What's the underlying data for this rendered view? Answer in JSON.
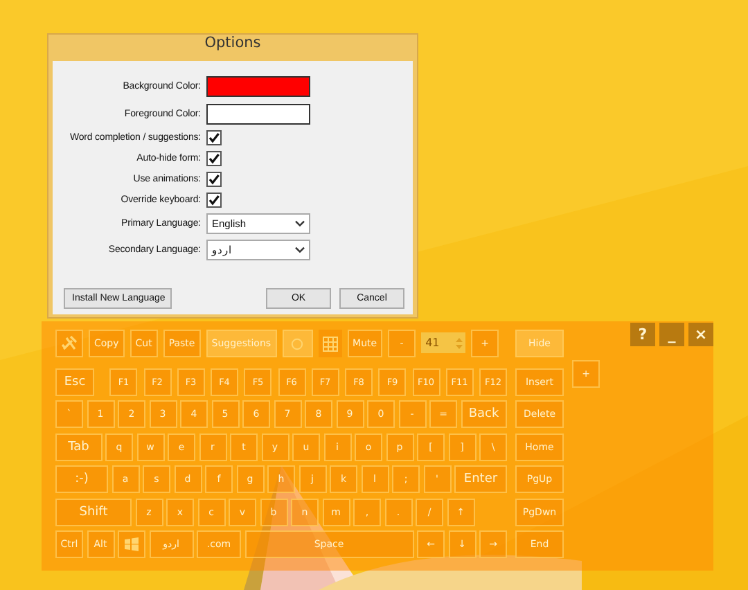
{
  "window": {
    "title": "Options"
  },
  "fields": [
    {
      "kind": "color",
      "label": "Background Color:",
      "color": "#ff0000"
    },
    {
      "kind": "color",
      "label": "Foreground Color:",
      "color": "#ffffff"
    },
    {
      "kind": "checkbox",
      "label": "Word completion / suggestions:",
      "checked": true
    },
    {
      "kind": "checkbox",
      "label": "Auto-hide form:",
      "checked": true
    },
    {
      "kind": "checkbox",
      "label": "Use animations:",
      "checked": true
    },
    {
      "kind": "checkbox",
      "label": "Override keyboard:",
      "checked": true
    },
    {
      "kind": "select",
      "label": "Primary Language:",
      "value": "English"
    },
    {
      "kind": "select",
      "label": "Secondary Language:",
      "value": "اردو"
    }
  ],
  "buttons": [
    "Install New Language",
    "OK",
    "Cancel"
  ],
  "keyboard": {
    "window_buttons": [
      "?",
      "_",
      "×"
    ],
    "toolbar": [
      {
        "kind": "tools",
        "on": false
      },
      {
        "kind": "key",
        "label": "Copy",
        "on": false
      },
      {
        "kind": "key",
        "label": "Cut",
        "on": false
      },
      {
        "kind": "key",
        "label": "Paste",
        "on": false
      },
      {
        "kind": "key",
        "label": "Suggestions",
        "on": true
      },
      {
        "kind": "circle",
        "on": true
      },
      {
        "kind": "grid",
        "on": false
      },
      {
        "kind": "key",
        "label": "Mute",
        "on": false
      },
      {
        "kind": "key",
        "label": "-",
        "on": false
      },
      {
        "kind": "spinner",
        "value": "41"
      },
      {
        "kind": "key",
        "label": "+",
        "on": false
      }
    ],
    "rows": [
      {
        "keys": [
          {
            "kind": "esc",
            "label": "Esc"
          },
          {
            "kind": "fn",
            "label": "F1"
          },
          {
            "kind": "fn",
            "label": "F2"
          },
          {
            "kind": "fn",
            "label": "F3"
          },
          {
            "kind": "fn",
            "label": "F4"
          },
          {
            "kind": "fn",
            "label": "F5"
          },
          {
            "kind": "fn",
            "label": "F6"
          },
          {
            "kind": "fn",
            "label": "F7"
          },
          {
            "kind": "fn",
            "label": "F8"
          },
          {
            "kind": "fn",
            "label": "F9"
          },
          {
            "kind": "fn",
            "label": "F10"
          },
          {
            "kind": "fn",
            "label": "F11"
          },
          {
            "kind": "fn",
            "label": "F12"
          }
        ]
      },
      {
        "keys": [
          {
            "kind": "key",
            "label": "`"
          },
          {
            "kind": "key",
            "label": "1"
          },
          {
            "kind": "key",
            "label": "2"
          },
          {
            "kind": "key",
            "label": "3"
          },
          {
            "kind": "key",
            "label": "4"
          },
          {
            "kind": "key",
            "label": "5"
          },
          {
            "kind": "key",
            "label": "6"
          },
          {
            "kind": "key",
            "label": "7"
          },
          {
            "kind": "key",
            "label": "8"
          },
          {
            "kind": "key",
            "label": "9"
          },
          {
            "kind": "key",
            "label": "0"
          },
          {
            "kind": "key",
            "label": "-"
          },
          {
            "kind": "key",
            "label": "="
          },
          {
            "kind": "wide",
            "label": "Back"
          }
        ]
      },
      {
        "keys": [
          {
            "kind": "wide",
            "label": "Tab"
          },
          {
            "kind": "key",
            "label": "q"
          },
          {
            "kind": "key",
            "label": "w"
          },
          {
            "kind": "key",
            "label": "e"
          },
          {
            "kind": "key",
            "label": "r"
          },
          {
            "kind": "key",
            "label": "t"
          },
          {
            "kind": "key",
            "label": "y"
          },
          {
            "kind": "key",
            "label": "u"
          },
          {
            "kind": "key",
            "label": "i"
          },
          {
            "kind": "key",
            "label": "o"
          },
          {
            "kind": "key",
            "label": "p"
          },
          {
            "kind": "key",
            "label": "["
          },
          {
            "kind": "key",
            "label": "]"
          },
          {
            "kind": "key",
            "label": "\\"
          }
        ]
      },
      {
        "keys": [
          {
            "kind": "wide",
            "label": ":-)"
          },
          {
            "kind": "key",
            "label": "a"
          },
          {
            "kind": "key",
            "label": "s"
          },
          {
            "kind": "key",
            "label": "d"
          },
          {
            "kind": "key",
            "label": "f"
          },
          {
            "kind": "key",
            "label": "g"
          },
          {
            "kind": "key",
            "label": "h"
          },
          {
            "kind": "key",
            "label": "j"
          },
          {
            "kind": "key",
            "label": "k"
          },
          {
            "kind": "key",
            "label": "l"
          },
          {
            "kind": "key",
            "label": ";"
          },
          {
            "kind": "key",
            "label": "'"
          },
          {
            "kind": "wide",
            "label": "Enter"
          }
        ]
      },
      {
        "keys": [
          {
            "kind": "shift",
            "label": "Shift"
          },
          {
            "kind": "key",
            "label": "z"
          },
          {
            "kind": "key",
            "label": "x"
          },
          {
            "kind": "key",
            "label": "c"
          },
          {
            "kind": "key",
            "label": "v"
          },
          {
            "kind": "key",
            "label": "b"
          },
          {
            "kind": "key",
            "label": "n"
          },
          {
            "kind": "key",
            "label": "m"
          },
          {
            "kind": "key",
            "label": ","
          },
          {
            "kind": "key",
            "label": "."
          },
          {
            "kind": "key",
            "label": "/"
          },
          {
            "kind": "key",
            "label": "↑"
          }
        ]
      },
      {
        "keys": [
          {
            "kind": "key",
            "label": "Ctrl"
          },
          {
            "kind": "key",
            "label": "Alt"
          },
          {
            "kind": "windows"
          },
          {
            "kind": "word",
            "label": "اردو"
          },
          {
            "kind": "word",
            "label": ".com"
          },
          {
            "kind": "space",
            "label": "Space"
          },
          {
            "kind": "key",
            "label": "←"
          },
          {
            "kind": "key",
            "label": "↓"
          },
          {
            "kind": "key",
            "label": "→"
          }
        ]
      }
    ],
    "nav_keys": [
      {
        "label": "Hide",
        "on": true
      },
      {
        "label": "Insert",
        "on": false
      },
      {
        "label": "Delete",
        "on": false
      },
      {
        "label": "Home",
        "on": false
      },
      {
        "label": "PgUp",
        "on": false
      },
      {
        "label": "PgDwn",
        "on": false
      },
      {
        "label": "End",
        "on": false
      }
    ],
    "side_key": "+"
  }
}
